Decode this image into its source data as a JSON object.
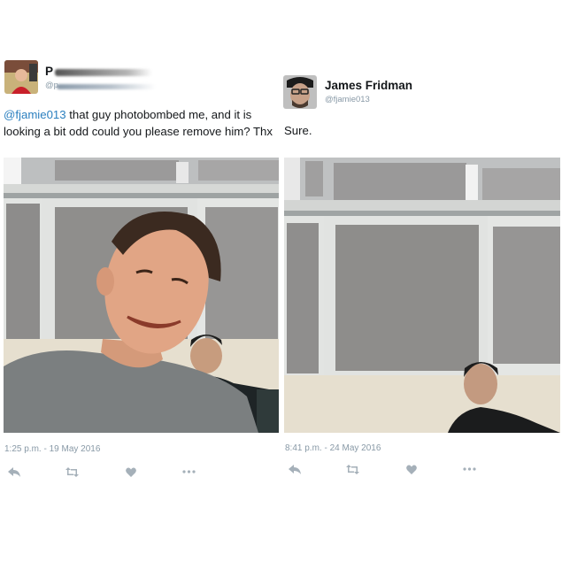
{
  "left_tweet": {
    "name_initial": "P",
    "handle_prefix": "@p",
    "mention": "@fjamie013",
    "text": " that guy photobombed me, and it is looking a bit odd could you please remove him? Thx",
    "time": "1:25 p.m.",
    "date": "19 May 2016",
    "separator": "-"
  },
  "right_tweet": {
    "name": "James Fridman",
    "handle": "@fjamie013",
    "text": "Sure.",
    "time": "8:41 p.m.",
    "date": "24 May 2016",
    "separator": "-"
  },
  "icons": [
    "reply-icon",
    "retweet-icon",
    "like-icon",
    "more-icon"
  ],
  "colors": {
    "link": "#2a7fbf",
    "meta": "#8899a6",
    "icon": "#a5b0b9"
  }
}
